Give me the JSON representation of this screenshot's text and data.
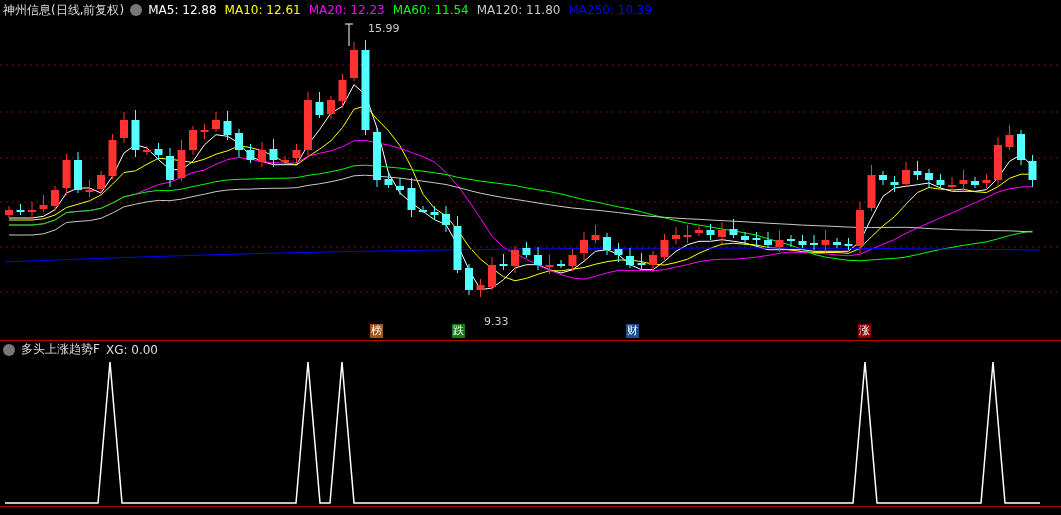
{
  "stock_header": {
    "title": "神州信息(日线,前复权)",
    "moving_averages": [
      {
        "text": "MA5: 12.88",
        "color": "#ffffff"
      },
      {
        "text": "MA10: 12.61",
        "color": "#ffff00"
      },
      {
        "text": "MA20: 12.23",
        "color": "#ff00ff"
      },
      {
        "text": "MA60: 11.54",
        "color": "#00ff00"
      },
      {
        "text": "MA120: 11.80",
        "color": "#c8c8c8"
      },
      {
        "text": "MA250: 10.39",
        "color": "#0000ff"
      }
    ]
  },
  "price_chart": {
    "high_label": "15.99",
    "low_label": "9.33",
    "markers": [
      {
        "text": "榜",
        "color": "#a0521a"
      },
      {
        "text": "跌",
        "color": "#1a7a1a"
      },
      {
        "text": "财",
        "color": "#1f4e8c"
      },
      {
        "text": "涨",
        "color": "#8b0000"
      }
    ]
  },
  "indicator_panel": {
    "title": "多头上涨趋势F",
    "reading": "XG: 0.00"
  }
}
